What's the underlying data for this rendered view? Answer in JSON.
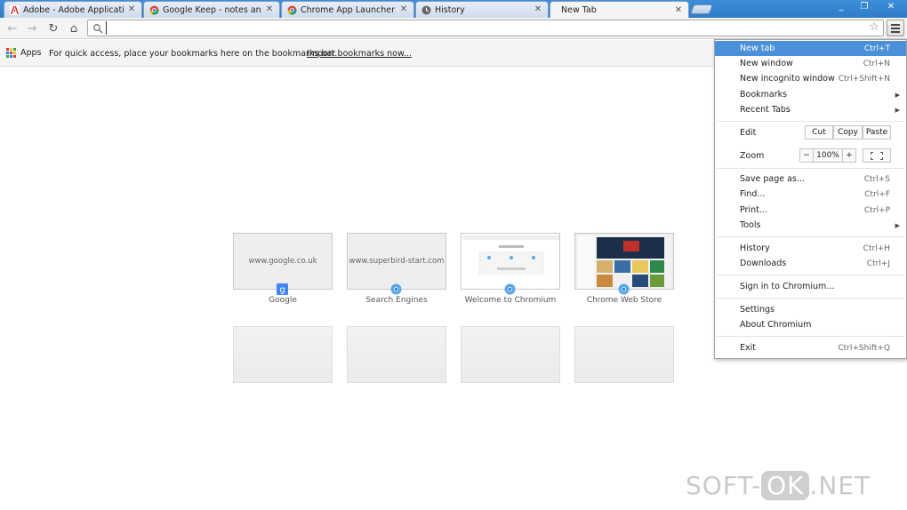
{
  "tabs": [
    {
      "title": "Adobe - Adobe Applicatio",
      "icon": "adobe-icon",
      "active": false
    },
    {
      "title": "Google Keep - notes and l",
      "icon": "chrome-webstore-icon",
      "active": false
    },
    {
      "title": "Chrome App Launcher",
      "icon": "chrome-webstore-icon",
      "active": false
    },
    {
      "title": "History",
      "icon": "history-icon",
      "active": false
    },
    {
      "title": "New Tab",
      "icon": "",
      "active": true
    }
  ],
  "window_controls": {
    "minimize": "_",
    "restore": "❐",
    "close": "✕"
  },
  "toolbar": {
    "back": "←",
    "forward": "→",
    "reload": "↻",
    "home": "⌂",
    "omnibox_value": ""
  },
  "bookmarks_bar": {
    "apps_label": "Apps",
    "hint": "For quick access, place your bookmarks here on the bookmarks bar.",
    "import_link": "Import bookmarks now..."
  },
  "most_visited": [
    {
      "label": "Google",
      "thumb_text": "www.google.co.uk",
      "icon": "google-icon"
    },
    {
      "label": "Search Engines",
      "thumb_text": "www.superbird-start.com",
      "icon": "chromium-icon"
    },
    {
      "label": "Welcome to Chromium",
      "thumb_text": "",
      "icon": "chromium-icon"
    },
    {
      "label": "Chrome Web Store",
      "thumb_text": "",
      "icon": "chromium-icon"
    }
  ],
  "menu": {
    "new_tab": {
      "label": "New tab",
      "shortcut": "Ctrl+T"
    },
    "new_window": {
      "label": "New window",
      "shortcut": "Ctrl+N"
    },
    "new_incognito": {
      "label": "New incognito window",
      "shortcut": "Ctrl+Shift+N"
    },
    "bookmarks": {
      "label": "Bookmarks"
    },
    "recent_tabs": {
      "label": "Recent Tabs"
    },
    "edit": {
      "label": "Edit",
      "cut": "Cut",
      "copy": "Copy",
      "paste": "Paste"
    },
    "zoom": {
      "label": "Zoom",
      "minus": "−",
      "value": "100%",
      "plus": "+"
    },
    "save_page": {
      "label": "Save page as...",
      "shortcut": "Ctrl+S"
    },
    "find": {
      "label": "Find...",
      "shortcut": "Ctrl+F"
    },
    "print": {
      "label": "Print...",
      "shortcut": "Ctrl+P"
    },
    "tools": {
      "label": "Tools"
    },
    "history": {
      "label": "History",
      "shortcut": "Ctrl+H"
    },
    "downloads": {
      "label": "Downloads",
      "shortcut": "Ctrl+J"
    },
    "sign_in": {
      "label": "Sign in to Chromium..."
    },
    "settings": {
      "label": "Settings"
    },
    "about": {
      "label": "About Chromium"
    },
    "exit": {
      "label": "Exit",
      "shortcut": "Ctrl+Shift+Q"
    }
  },
  "watermark": {
    "left": "SOFT-",
    "box": "OK",
    "right": ".NET"
  },
  "colors": {
    "tabstrip": "#2f7bc9",
    "menu_highlight": "#4a90d9"
  }
}
